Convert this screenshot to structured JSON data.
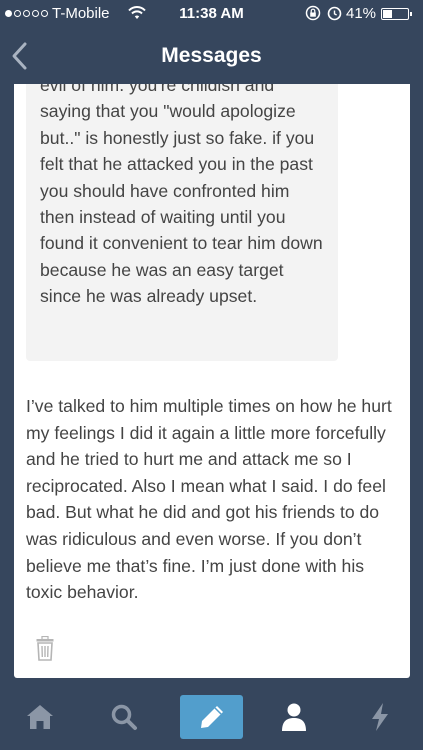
{
  "status_bar": {
    "carrier": "T-Mobile",
    "time": "11:38 AM",
    "battery_percent": "41%",
    "battery_level": 0.41,
    "signal_bars_filled": 1,
    "signal_bars_total": 5
  },
  "nav": {
    "title": "Messages",
    "back_icon": "chevron-left-icon"
  },
  "message": {
    "quoted_text": "evil of him. you're childish and saying that you \"would apologize but..\" is honestly just so fake. if you felt that he attacked you in the past you should have confronted him then instead of waiting until you found it convenient to tear him down because he was an easy target since he was already upset.",
    "reply_text": "I’ve talked to him multiple times on how he hurt my feelings I did it again a little more forcefully and he tried to hurt me and attack me so I reciprocated. Also I mean what I said. I do feel bad. But what he did and got his friends to do was ridiculous and even worse. If you don’t believe me that’s fine. I’m just done with his toxic behavior."
  },
  "tab_bar": {
    "items": [
      {
        "icon": "home-icon"
      },
      {
        "icon": "search-icon"
      },
      {
        "icon": "pencil-icon",
        "active": true
      },
      {
        "icon": "person-icon"
      },
      {
        "icon": "lightning-icon"
      }
    ]
  },
  "colors": {
    "background": "#36465d",
    "accent": "#529ecc",
    "card": "#ffffff",
    "quote_bg": "#f3f3f3",
    "text": "#444444",
    "inactive_icon": "#8b96a6"
  }
}
